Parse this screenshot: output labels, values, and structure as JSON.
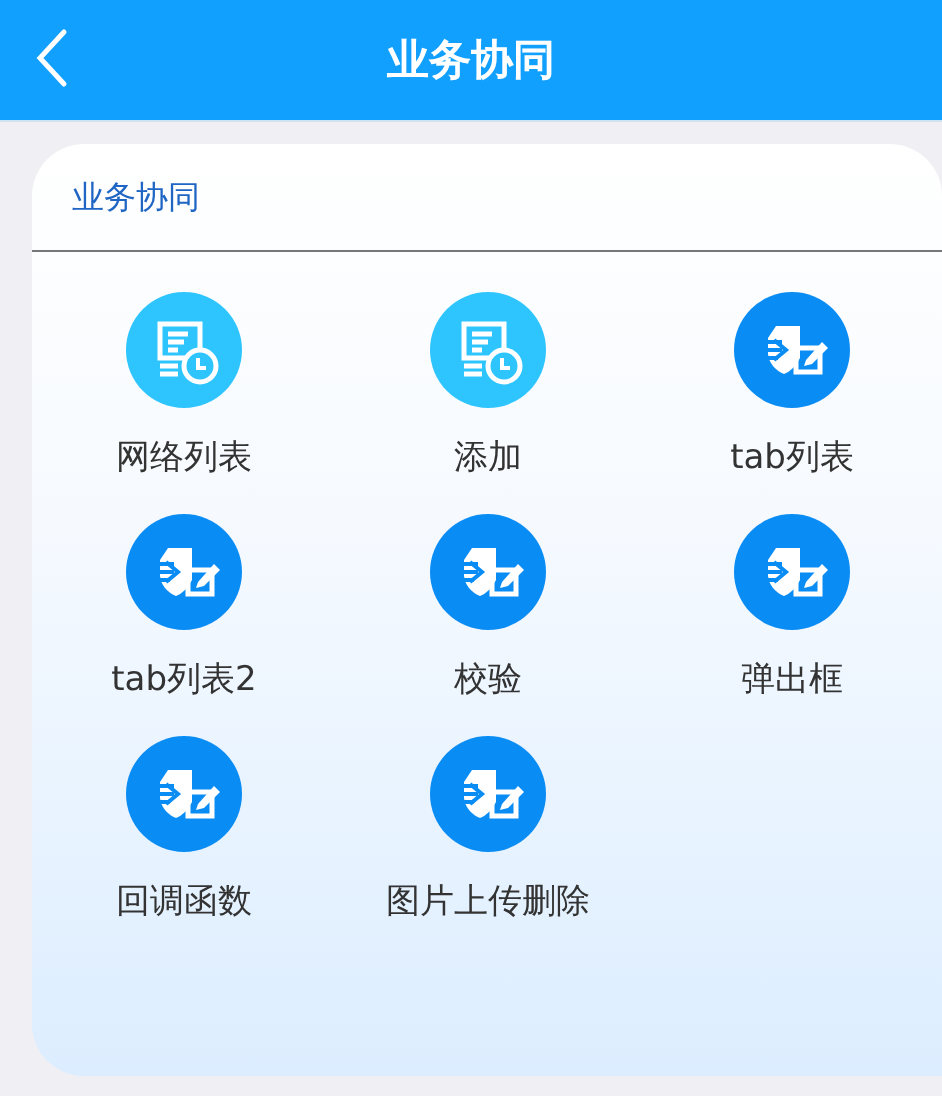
{
  "header": {
    "title": "业务协同"
  },
  "card": {
    "title": "业务协同",
    "items": [
      {
        "label": "网络列表",
        "kind": "document"
      },
      {
        "label": "添加",
        "kind": "document"
      },
      {
        "label": "tab列表",
        "kind": "shield"
      },
      {
        "label": "tab列表2",
        "kind": "shield"
      },
      {
        "label": "校验",
        "kind": "shield"
      },
      {
        "label": "弹出框",
        "kind": "shield"
      },
      {
        "label": "回调函数",
        "kind": "shield"
      },
      {
        "label": "图片上传删除",
        "kind": "shield"
      }
    ]
  }
}
